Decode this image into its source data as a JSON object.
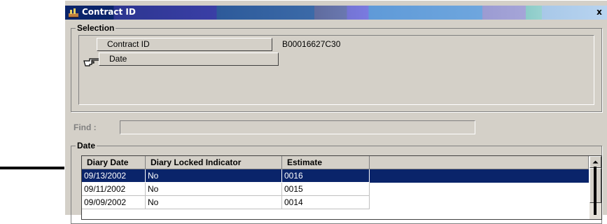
{
  "window": {
    "title": "Contract ID",
    "close_glyph": "x",
    "icon": "app-window-icon"
  },
  "selection": {
    "group_label": "Selection",
    "rows": [
      {
        "label": "Contract ID",
        "value": "B00016627C30"
      },
      {
        "label": "Date",
        "value": ""
      }
    ],
    "current_row_icon": "pointing-hand-icon"
  },
  "find": {
    "label": "Find :",
    "value": ""
  },
  "date_section": {
    "group_label": "Date",
    "columns": [
      "Diary Date",
      "Diary Locked Indicator",
      "Estimate"
    ],
    "rows": [
      {
        "diary_date": "09/13/2002",
        "locked": "No",
        "estimate": "0016",
        "selected": true
      },
      {
        "diary_date": "09/11/2002",
        "locked": "No",
        "estimate": "0015",
        "selected": false
      },
      {
        "diary_date": "09/09/2002",
        "locked": "No",
        "estimate": "0014",
        "selected": false
      }
    ]
  },
  "colors": {
    "dialog_face": "#d4d0c8",
    "selection_highlight": "#0a246a",
    "title_text": "#ffffff"
  }
}
